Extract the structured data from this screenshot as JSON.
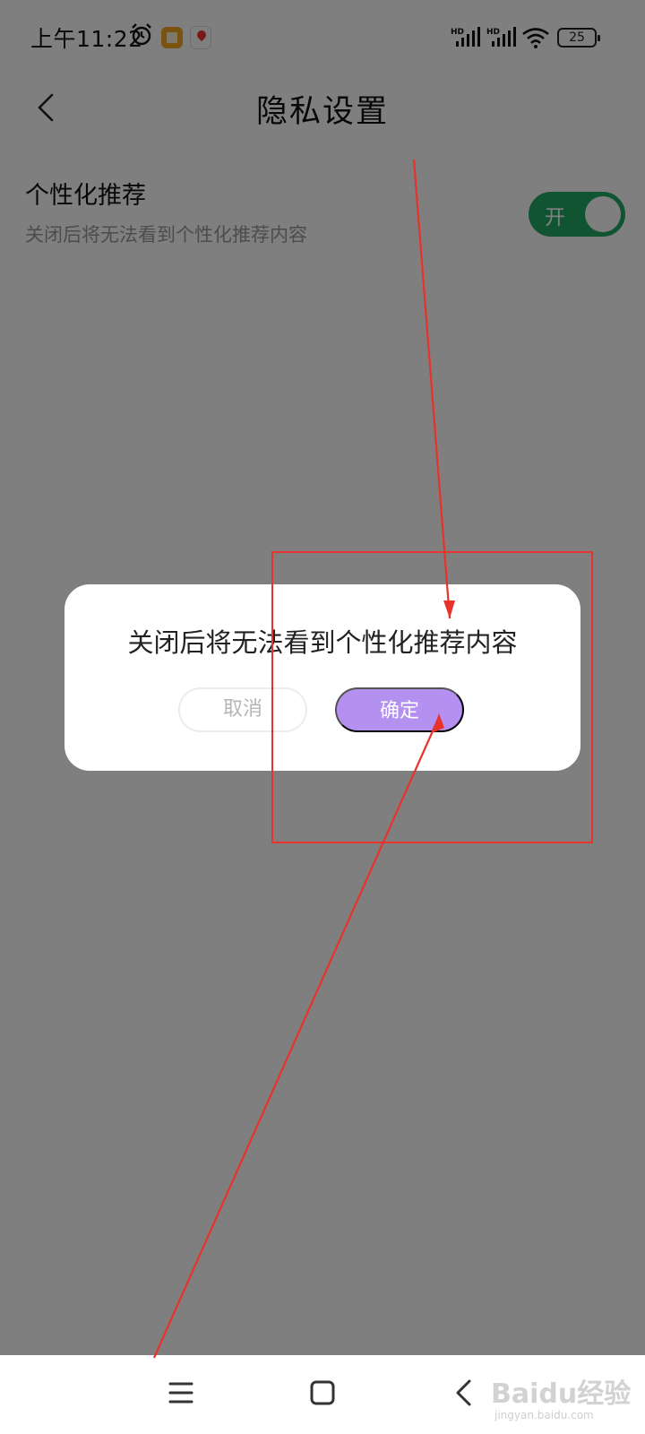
{
  "status_bar": {
    "time": "上午11:22",
    "battery": "25",
    "icons": [
      "alarm-icon",
      "app-note-icon",
      "app-map-icon",
      "hd-signal-icon",
      "hd-signal-icon",
      "wifi-icon",
      "battery-icon"
    ]
  },
  "header": {
    "title": "隐私设置",
    "back_icon": "chevron-left-icon"
  },
  "settings": {
    "personalized": {
      "title": "个性化推荐",
      "description": "关闭后将无法看到个性化推荐内容",
      "toggle_label": "开",
      "toggle_state": "on",
      "toggle_color": "#20a864"
    }
  },
  "dialog": {
    "message": "关闭后将无法看到个性化推荐内容",
    "cancel_label": "取消",
    "confirm_label": "确定",
    "confirm_color": "#b490f0"
  },
  "navigation_bar": {
    "icons": [
      "menu-icon",
      "home-icon",
      "back-icon"
    ]
  },
  "watermark": {
    "text": "Baidu经验",
    "sub": "jingyan.baidu.com"
  },
  "annotation_color": "#e8322b"
}
